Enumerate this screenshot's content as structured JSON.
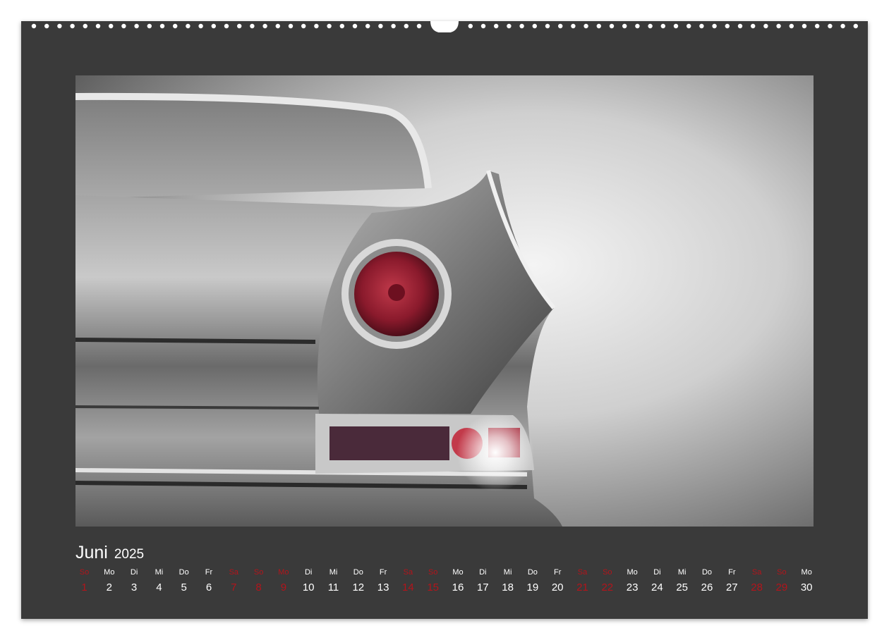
{
  "calendar": {
    "month": "Juni",
    "year": "2025",
    "days": [
      {
        "dow": "So",
        "num": "1",
        "weekend": true
      },
      {
        "dow": "Mo",
        "num": "2",
        "weekend": false
      },
      {
        "dow": "Di",
        "num": "3",
        "weekend": false
      },
      {
        "dow": "Mi",
        "num": "4",
        "weekend": false
      },
      {
        "dow": "Do",
        "num": "5",
        "weekend": false
      },
      {
        "dow": "Fr",
        "num": "6",
        "weekend": false
      },
      {
        "dow": "Sa",
        "num": "7",
        "weekend": true
      },
      {
        "dow": "So",
        "num": "8",
        "weekend": true
      },
      {
        "dow": "Mo",
        "num": "9",
        "weekend": true
      },
      {
        "dow": "Di",
        "num": "10",
        "weekend": false
      },
      {
        "dow": "Mi",
        "num": "11",
        "weekend": false
      },
      {
        "dow": "Do",
        "num": "12",
        "weekend": false
      },
      {
        "dow": "Fr",
        "num": "13",
        "weekend": false
      },
      {
        "dow": "Sa",
        "num": "14",
        "weekend": true
      },
      {
        "dow": "So",
        "num": "15",
        "weekend": true
      },
      {
        "dow": "Mo",
        "num": "16",
        "weekend": false
      },
      {
        "dow": "Di",
        "num": "17",
        "weekend": false
      },
      {
        "dow": "Mi",
        "num": "18",
        "weekend": false
      },
      {
        "dow": "Do",
        "num": "19",
        "weekend": false
      },
      {
        "dow": "Fr",
        "num": "20",
        "weekend": false
      },
      {
        "dow": "Sa",
        "num": "21",
        "weekend": true
      },
      {
        "dow": "So",
        "num": "22",
        "weekend": true
      },
      {
        "dow": "Mo",
        "num": "23",
        "weekend": false
      },
      {
        "dow": "Di",
        "num": "24",
        "weekend": false
      },
      {
        "dow": "Mi",
        "num": "25",
        "weekend": false
      },
      {
        "dow": "Do",
        "num": "26",
        "weekend": false
      },
      {
        "dow": "Fr",
        "num": "27",
        "weekend": false
      },
      {
        "dow": "Sa",
        "num": "28",
        "weekend": true
      },
      {
        "dow": "So",
        "num": "29",
        "weekend": true
      },
      {
        "dow": "Mo",
        "num": "30",
        "weekend": false
      }
    ]
  },
  "colors": {
    "background": "#3a3a3a",
    "weekday_text": "#ffffff",
    "holiday_weekend_text": "#b3141b"
  },
  "photo": {
    "subject": "classic-car-tail-fin-taillight-photo"
  }
}
